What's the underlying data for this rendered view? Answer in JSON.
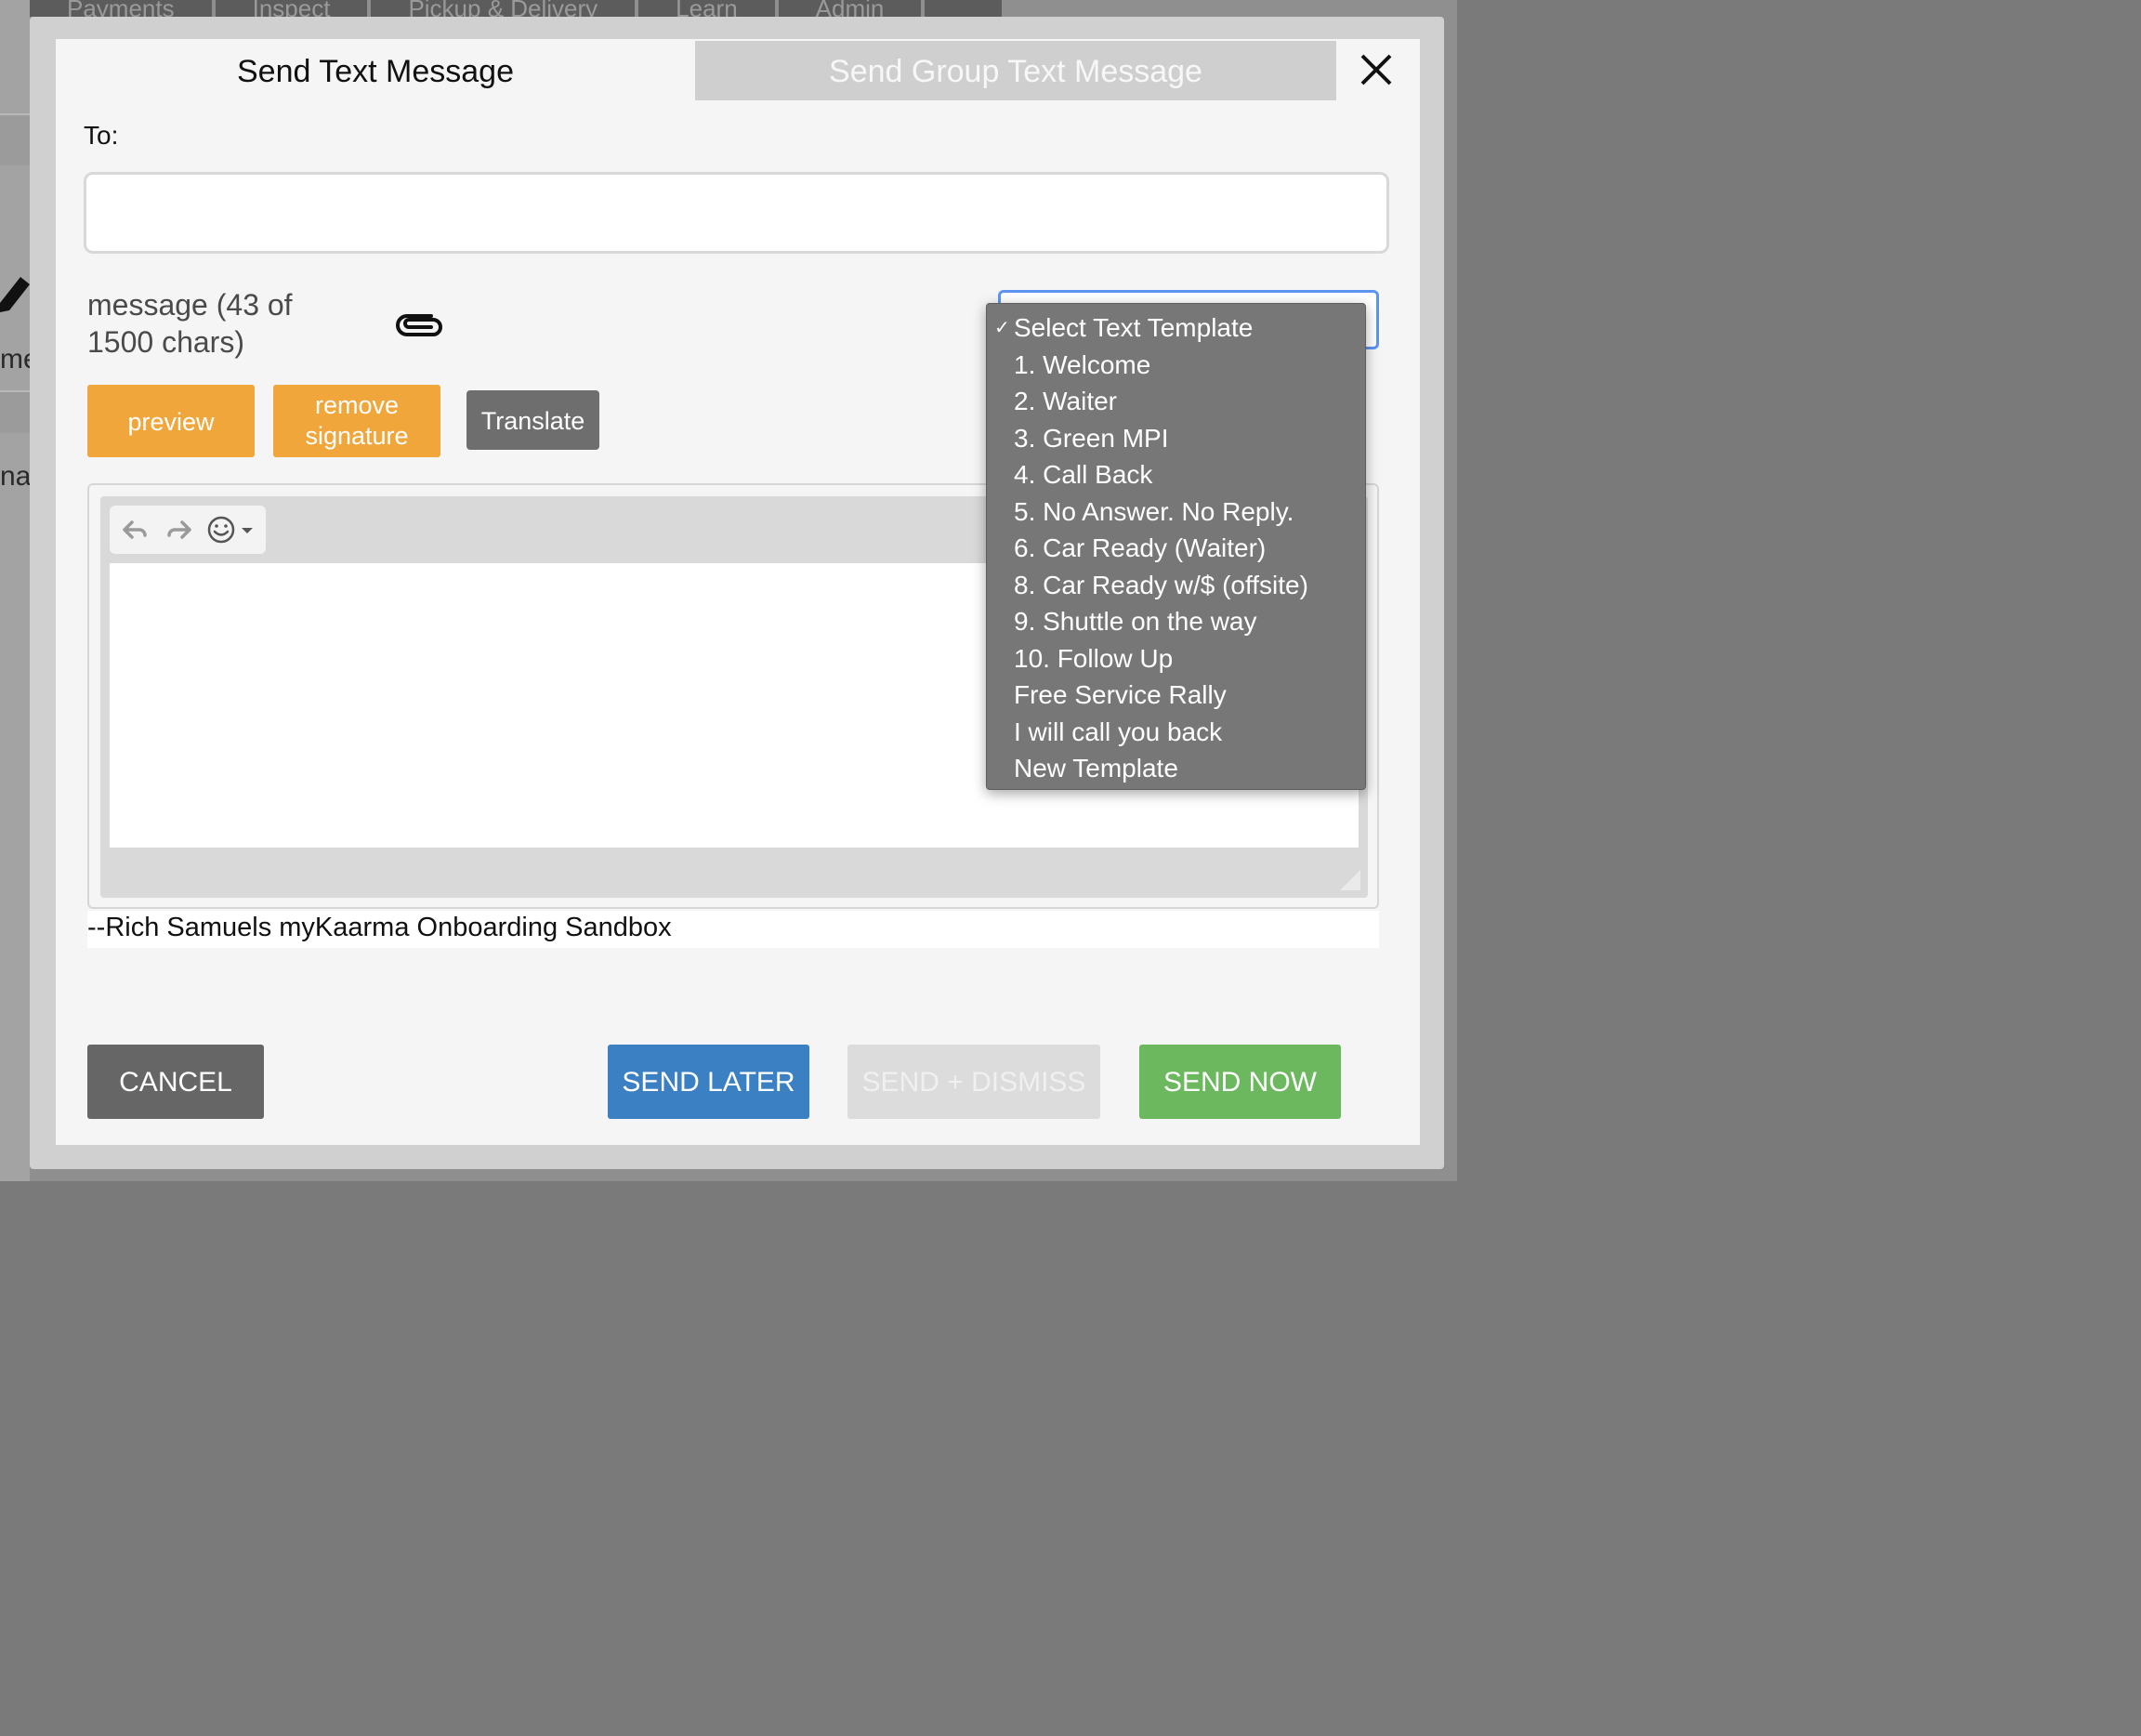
{
  "background": {
    "nav_tabs": [
      "Payments",
      "Inspect",
      "Pickup & Delivery",
      "Learn",
      "Admin"
    ],
    "side_text_1": "me",
    "side_text_2": "nai"
  },
  "modal": {
    "tabs": {
      "active": "Send Text Message",
      "inactive": "Send Group Text Message"
    },
    "close_icon": "close-icon",
    "to_label": "To:",
    "to_value": "",
    "message_count": "message (43 of 1500 chars)",
    "attach_icon": "paperclip-icon",
    "buttons": {
      "preview": "preview",
      "remove_signature": "remove signature",
      "translate": "Translate"
    },
    "editor": {
      "undo_icon": "undo-icon",
      "redo_icon": "redo-icon",
      "emoji_icon": "emoji-icon",
      "content": ""
    },
    "signature": "--Rich Samuels myKaarma Onboarding Sandbox",
    "footer": {
      "cancel": "CANCEL",
      "send_later": "SEND LATER",
      "send_dismiss": "SEND + DISMISS",
      "send_now": "SEND NOW"
    },
    "template_select": {
      "selected": "Select Text Template",
      "options": [
        "Select Text Template",
        "1. Welcome",
        "2. Waiter",
        "3. Green MPI",
        "4. Call Back",
        "5. No Answer. No Reply.",
        "6. Car Ready (Waiter)",
        "8. Car Ready w/$ (offsite)",
        "9. Shuttle on the way",
        "10. Follow Up",
        "Free Service Rally",
        "I will call you back",
        "New Template"
      ]
    }
  },
  "colors": {
    "accent_orange": "#f0a63a",
    "send_later_blue": "#3a80c2",
    "send_now_green": "#6cb85f",
    "cancel_gray": "#666666",
    "focus_blue": "#5b95f0"
  }
}
